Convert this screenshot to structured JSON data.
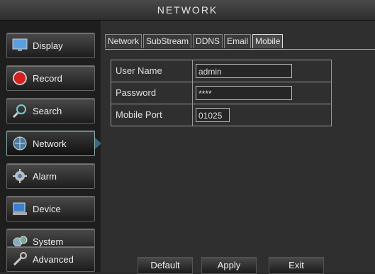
{
  "window": {
    "title": "NETWORK"
  },
  "sidebar": {
    "items": [
      {
        "label": "Display",
        "icon": "monitor-icon"
      },
      {
        "label": "Record",
        "icon": "record-icon"
      },
      {
        "label": "Search",
        "icon": "search-icon"
      },
      {
        "label": "Network",
        "icon": "network-icon"
      },
      {
        "label": "Alarm",
        "icon": "alarm-icon"
      },
      {
        "label": "Device",
        "icon": "device-icon"
      },
      {
        "label": "System",
        "icon": "system-icon"
      },
      {
        "label": "Advanced",
        "icon": "advanced-icon"
      }
    ],
    "active": "Network"
  },
  "tabs": [
    {
      "label": "Network"
    },
    {
      "label": "SubStream"
    },
    {
      "label": "DDNS"
    },
    {
      "label": "Email"
    },
    {
      "label": "Mobile"
    }
  ],
  "active_tab": "Mobile",
  "form": {
    "username_label": "User Name",
    "username_value": "admin",
    "password_label": "Password",
    "password_value": "****",
    "port_label": "Mobile Port",
    "port_value": "01025"
  },
  "buttons": {
    "default_label": "Default",
    "apply_label": "Apply",
    "exit_label": "Exit"
  }
}
